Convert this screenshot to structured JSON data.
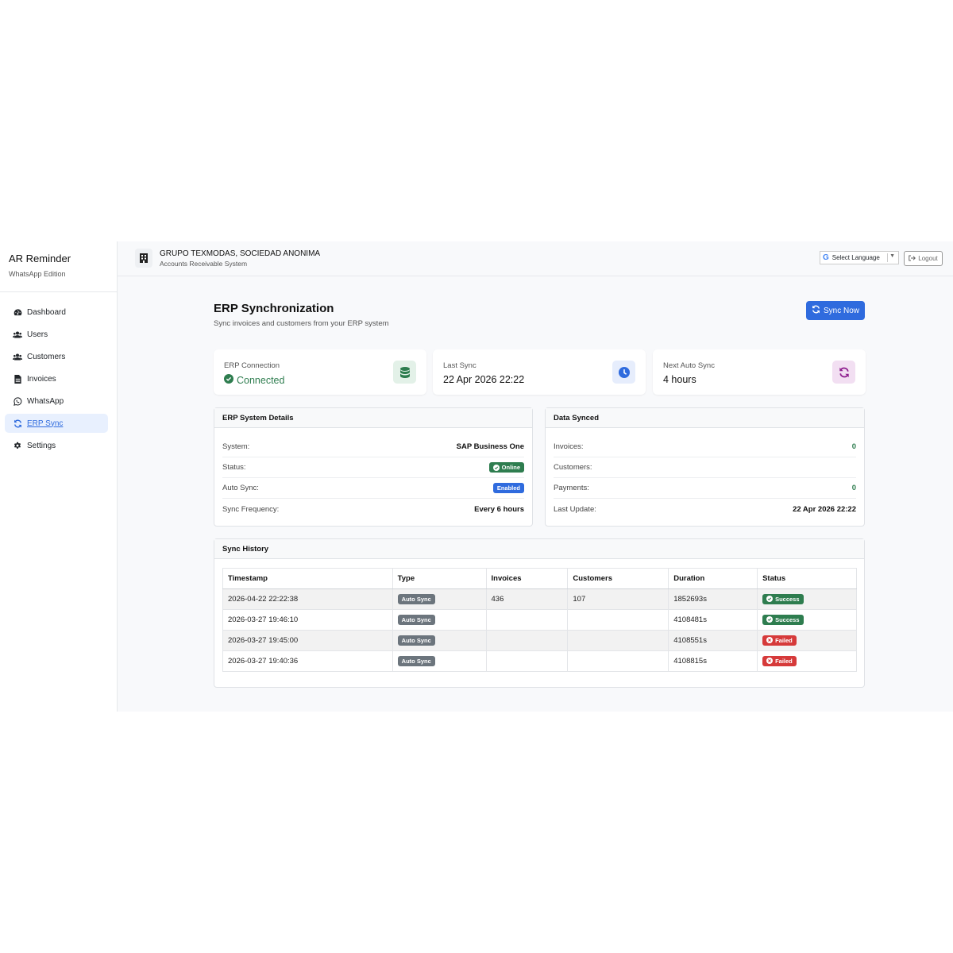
{
  "app": {
    "title": "AR Reminder",
    "subtitle": "WhatsApp Edition"
  },
  "sidebar": {
    "items": [
      {
        "label": "Dashboard",
        "icon": "dashboard-icon"
      },
      {
        "label": "Users",
        "icon": "users-icon"
      },
      {
        "label": "Customers",
        "icon": "customers-icon"
      },
      {
        "label": "Invoices",
        "icon": "invoice-icon"
      },
      {
        "label": "WhatsApp",
        "icon": "whatsapp-icon"
      },
      {
        "label": "ERP Sync",
        "icon": "sync-icon",
        "active": true
      },
      {
        "label": "Settings",
        "icon": "gear-icon"
      }
    ]
  },
  "header": {
    "company": "GRUPO TEXMODAS, SOCIEDAD ANONIMA",
    "company_sub": "Accounts Receivable System",
    "language_label": "Select Language",
    "logout_label": "Logout"
  },
  "page": {
    "title": "ERP Synchronization",
    "subtitle": "Sync invoices and customers from your ERP system",
    "sync_button": "Sync Now"
  },
  "stats": {
    "connection": {
      "label": "ERP Connection",
      "value": "Connected"
    },
    "last_sync": {
      "label": "Last Sync",
      "value": "22 Apr 2026 22:22"
    },
    "next_sync": {
      "label": "Next Auto Sync",
      "value": "4 hours"
    }
  },
  "erp_details": {
    "title": "ERP System Details",
    "system_label": "System:",
    "system_value": "SAP Business One",
    "status_label": "Status:",
    "status_value": "Online",
    "auto_label": "Auto Sync:",
    "auto_value": "Enabled",
    "freq_label": "Sync Frequency:",
    "freq_value": "Every 6 hours"
  },
  "data_synced": {
    "title": "Data Synced",
    "invoices_label": "Invoices:",
    "invoices_value": "0",
    "customers_label": "Customers:",
    "customers_value": "",
    "payments_label": "Payments:",
    "payments_value": "0",
    "update_label": "Last Update:",
    "update_value": "22 Apr 2026 22:22"
  },
  "history": {
    "title": "Sync History",
    "columns": [
      "Timestamp",
      "Type",
      "Invoices",
      "Customers",
      "Duration",
      "Status"
    ],
    "rows": [
      {
        "timestamp": "2026-04-22 22:22:38",
        "type": "Auto Sync",
        "invoices": "436",
        "customers": "107",
        "duration": "1852693s",
        "status": "Success"
      },
      {
        "timestamp": "2026-03-27 19:46:10",
        "type": "Auto Sync",
        "invoices": "",
        "customers": "",
        "duration": "4108481s",
        "status": "Success"
      },
      {
        "timestamp": "2026-03-27 19:45:00",
        "type": "Auto Sync",
        "invoices": "",
        "customers": "",
        "duration": "4108551s",
        "status": "Failed"
      },
      {
        "timestamp": "2026-03-27 19:40:36",
        "type": "Auto Sync",
        "invoices": "",
        "customers": "",
        "duration": "4108815s",
        "status": "Failed"
      }
    ]
  },
  "colors": {
    "primary": "#2f6bde",
    "success": "#2e7d4f",
    "danger": "#d63a3a",
    "secondary": "#6c757d"
  }
}
